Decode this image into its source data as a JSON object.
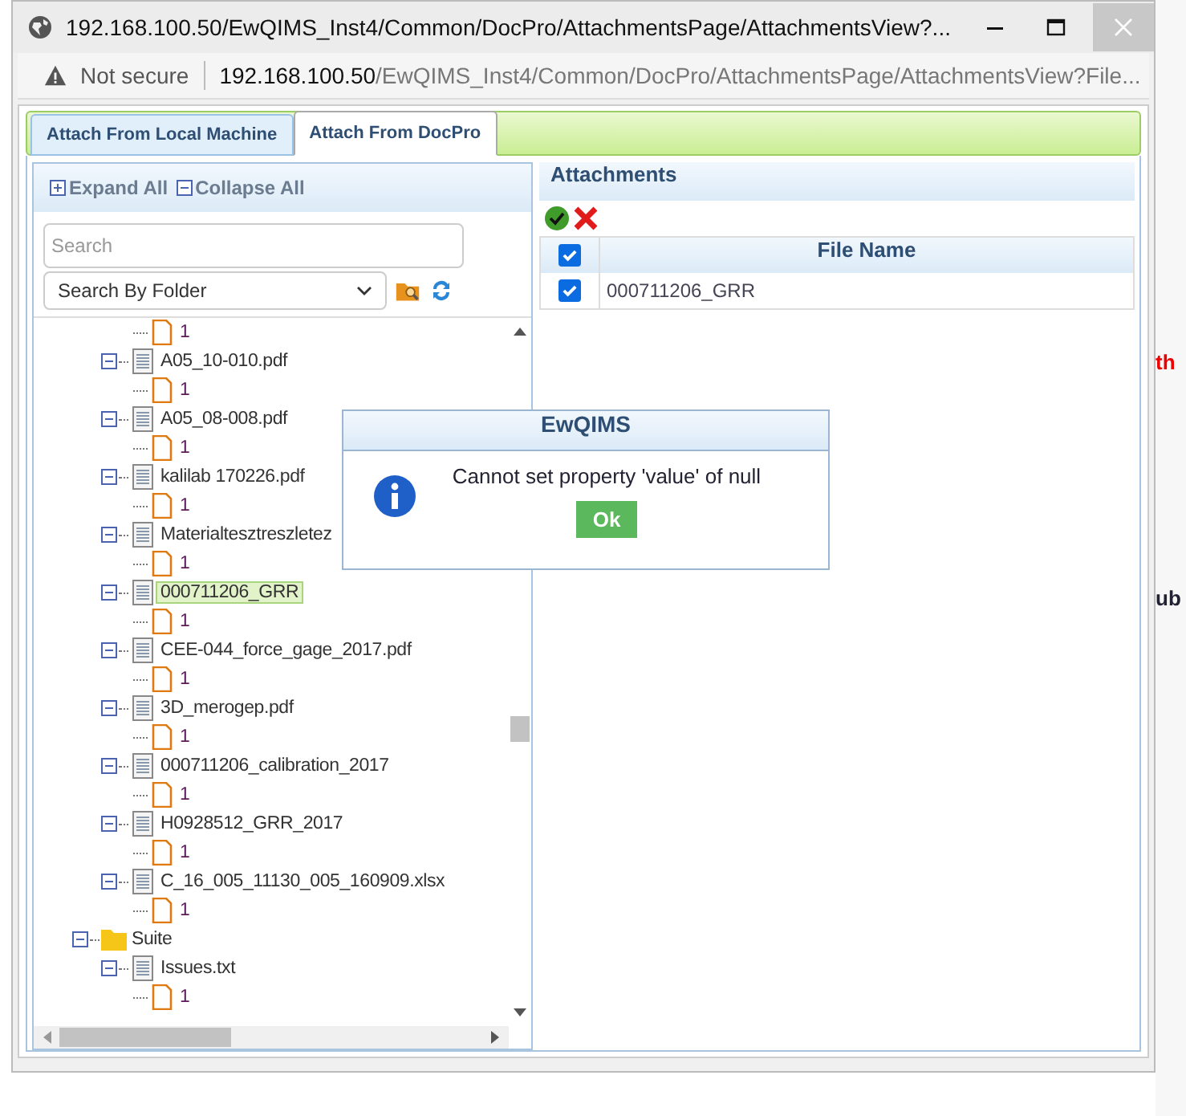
{
  "window": {
    "title": "192.168.100.50/EwQIMS_Inst4/Common/DocPro/AttachmentsPage/AttachmentsView?..."
  },
  "address_bar": {
    "security": "Not secure",
    "host": "192.168.100.50",
    "path": "/EwQIMS_Inst4/Common/DocPro/AttachmentsPage/AttachmentsView?File..."
  },
  "tabs": [
    {
      "label": "Attach From Local Machine",
      "selected": false
    },
    {
      "label": "Attach From DocPro",
      "selected": true
    }
  ],
  "tree_panel": {
    "expand_all": "Expand All",
    "collapse_all": "Collapse All",
    "search": {
      "placeholder": "Search"
    },
    "search_mode": "Search By Folder",
    "items": [
      {
        "children": [
          {
            "children": [
              {
                "kind": "page",
                "label": "1"
              }
            ]
          },
          {
            "kind": "file",
            "label": "A05_10-010.pdf",
            "expanded": true,
            "selected": false,
            "children": [
              {
                "kind": "page",
                "label": "1"
              }
            ]
          },
          {
            "kind": "file",
            "label": "A05_08-008.pdf",
            "expanded": true,
            "selected": false,
            "children": [
              {
                "kind": "page",
                "label": "1"
              }
            ]
          },
          {
            "kind": "file",
            "label": "kalilab 170226.pdf",
            "expanded": true,
            "selected": false,
            "children": [
              {
                "kind": "page",
                "label": "1"
              }
            ]
          },
          {
            "kind": "file",
            "label": "Materialtesztreszletez",
            "expanded": true,
            "selected": false,
            "children": [
              {
                "kind": "page",
                "label": "1"
              }
            ]
          },
          {
            "kind": "file",
            "label": "000711206_GRR",
            "expanded": true,
            "selected": true,
            "children": [
              {
                "kind": "page",
                "label": "1"
              }
            ]
          },
          {
            "kind": "file",
            "label": "CEE-044_force_gage_2017.pdf",
            "expanded": true,
            "selected": false,
            "children": [
              {
                "kind": "page",
                "label": "1"
              }
            ]
          },
          {
            "kind": "file",
            "label": "3D_merogep.pdf",
            "expanded": true,
            "selected": false,
            "children": [
              {
                "kind": "page",
                "label": "1"
              }
            ]
          },
          {
            "kind": "file",
            "label": "000711206_calibration_2017",
            "expanded": true,
            "selected": false,
            "children": [
              {
                "kind": "page",
                "label": "1"
              }
            ]
          },
          {
            "kind": "file",
            "label": "H0928512_GRR_2017",
            "expanded": true,
            "selected": false,
            "children": [
              {
                "kind": "page",
                "label": "1"
              }
            ]
          },
          {
            "kind": "file",
            "label": "C_16_005_11130_005_160909.xlsx",
            "expanded": true,
            "selected": false,
            "children": [
              {
                "kind": "page",
                "label": "1"
              }
            ]
          }
        ]
      },
      {
        "kind": "folder",
        "label": "Suite",
        "expanded": true,
        "selected": false,
        "children": [
          {
            "kind": "file",
            "label": "Issues.txt",
            "expanded": true,
            "selected": false,
            "children": [
              {
                "kind": "page",
                "label": "1"
              }
            ]
          }
        ]
      }
    ]
  },
  "attachments": {
    "title": "Attachments",
    "all_checked": true,
    "column": "File Name",
    "rows": [
      {
        "file_name": "000711206_GRR",
        "checked": true
      }
    ]
  },
  "dialog": {
    "title": "EwQIMS",
    "message": "Cannot set property 'value' of null",
    "button": "Ok"
  },
  "background_page": {
    "texts": [
      "th",
      "ub"
    ]
  }
}
